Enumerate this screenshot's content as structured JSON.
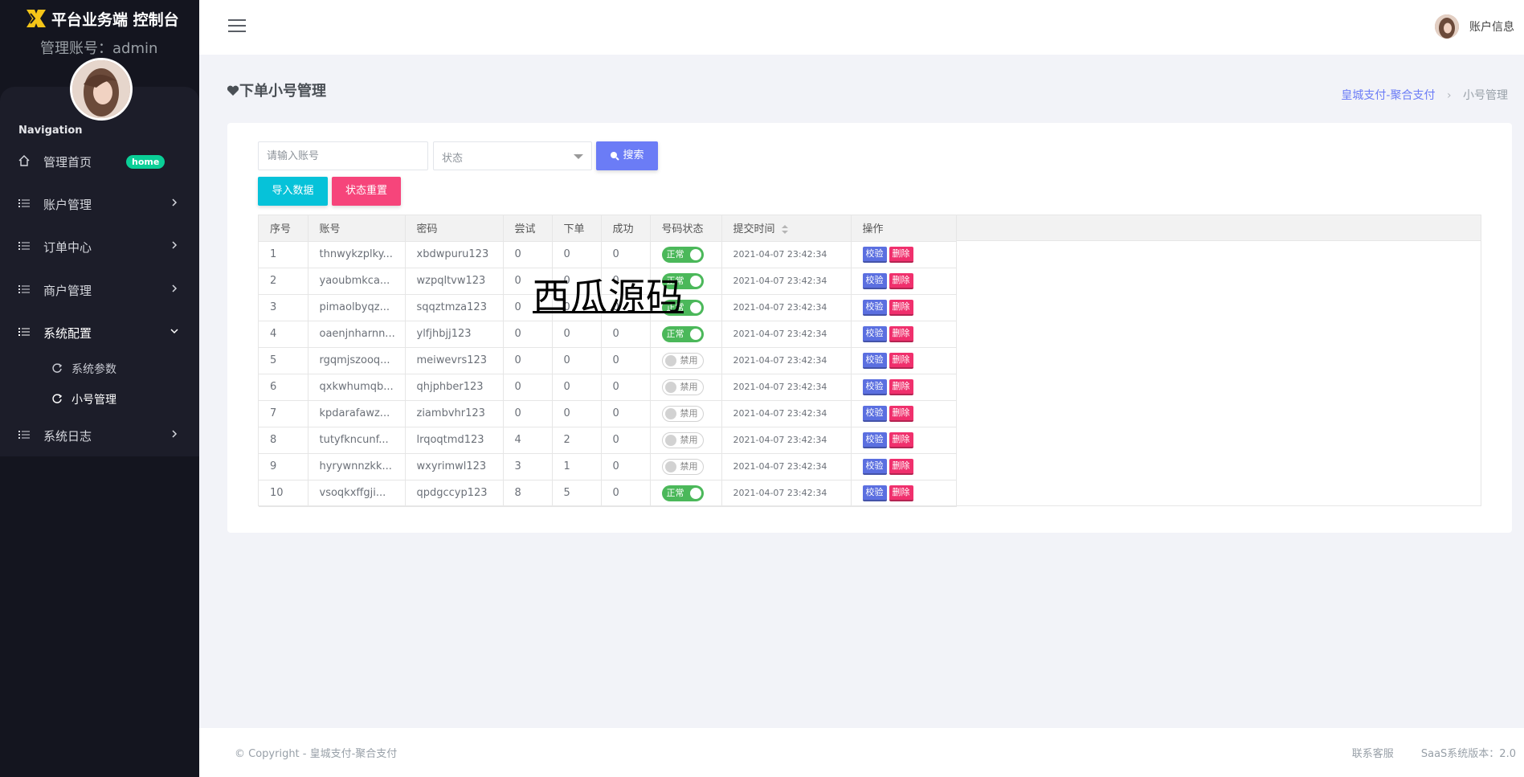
{
  "sidebar": {
    "brand_title": "平台业务端 控制台",
    "account_text": "管理账号：admin",
    "nav_title": "Navigation",
    "items": [
      {
        "label": "管理首页",
        "badge": "home",
        "icon": "home-icon"
      },
      {
        "label": "账户管理",
        "icon": "list-icon"
      },
      {
        "label": "订单中心",
        "icon": "list-icon"
      },
      {
        "label": "商户管理",
        "icon": "list-icon"
      },
      {
        "label": "系统配置",
        "icon": "list-icon",
        "expanded": true
      },
      {
        "label": "系统日志",
        "icon": "list-icon"
      }
    ],
    "subitems": [
      {
        "label": "系统参数",
        "icon": "refresh-icon"
      },
      {
        "label": "小号管理",
        "icon": "refresh-icon",
        "active": true
      }
    ]
  },
  "topbar": {
    "account_label": "账户信息"
  },
  "page": {
    "title": "下单小号管理",
    "breadcrumb": {
      "link": "皇城支付-聚合支付",
      "separator": "›",
      "current": "小号管理"
    }
  },
  "filters": {
    "account_placeholder": "请输入账号",
    "status_value": "状态",
    "search_label": "搜索",
    "import_label": "导入数据",
    "reset_label": "状态重置"
  },
  "table": {
    "headers": [
      "序号",
      "账号",
      "密码",
      "尝试",
      "下单",
      "成功",
      "号码状态",
      "提交时间",
      "操作"
    ],
    "actions": {
      "verify": "校验",
      "delete": "删除"
    },
    "status_labels": {
      "on": "正常",
      "off": "禁用"
    },
    "rows": [
      {
        "id": "1",
        "account": "thnwykzplky...",
        "password": "xbdwpuru123",
        "tries": "0",
        "orders": "0",
        "success": "0",
        "status": "on",
        "time": "2021-04-07 23:42:34"
      },
      {
        "id": "2",
        "account": "yaoubmkca...",
        "password": "wzpqltvw123",
        "tries": "0",
        "orders": "0",
        "success": "0",
        "status": "on",
        "time": "2021-04-07 23:42:34"
      },
      {
        "id": "3",
        "account": "pimaolbyqz...",
        "password": "sqqztmza123",
        "tries": "0",
        "orders": "0",
        "success": "0",
        "status": "on",
        "time": "2021-04-07 23:42:34"
      },
      {
        "id": "4",
        "account": "oaenjnharnn...",
        "password": "ylfjhbjj123",
        "tries": "0",
        "orders": "0",
        "success": "0",
        "status": "on",
        "time": "2021-04-07 23:42:34"
      },
      {
        "id": "5",
        "account": "rgqmjszooq...",
        "password": "meiwevrs123",
        "tries": "0",
        "orders": "0",
        "success": "0",
        "status": "off",
        "time": "2021-04-07 23:42:34"
      },
      {
        "id": "6",
        "account": "qxkwhumqb...",
        "password": "qhjphber123",
        "tries": "0",
        "orders": "0",
        "success": "0",
        "status": "off",
        "time": "2021-04-07 23:42:34"
      },
      {
        "id": "7",
        "account": "kpdarafawz...",
        "password": "ziambvhr123",
        "tries": "0",
        "orders": "0",
        "success": "0",
        "status": "off",
        "time": "2021-04-07 23:42:34"
      },
      {
        "id": "8",
        "account": "tutyfkncunf...",
        "password": "lrqoqtmd123",
        "tries": "4",
        "orders": "2",
        "success": "0",
        "status": "off",
        "time": "2021-04-07 23:42:34"
      },
      {
        "id": "9",
        "account": "hyrywnnzkk...",
        "password": "wxyrimwl123",
        "tries": "3",
        "orders": "1",
        "success": "0",
        "status": "off",
        "time": "2021-04-07 23:42:34"
      },
      {
        "id": "10",
        "account": "vsoqkxffgji...",
        "password": "qpdgccyp123",
        "tries": "8",
        "orders": "5",
        "success": "0",
        "status": "on",
        "time": "2021-04-07 23:42:34"
      }
    ]
  },
  "watermark": "西瓜源码",
  "footer": {
    "copyright": "© Copyright - 皇城支付-聚合支付",
    "support": "联系客服",
    "version": "SaaS系统版本：2.0"
  },
  "colors": {
    "accent": "#6b7cf6",
    "cyan": "#06c2d9",
    "pink": "#f6457b",
    "green": "#4bb85a",
    "sidebar_bg": "#14151f"
  }
}
